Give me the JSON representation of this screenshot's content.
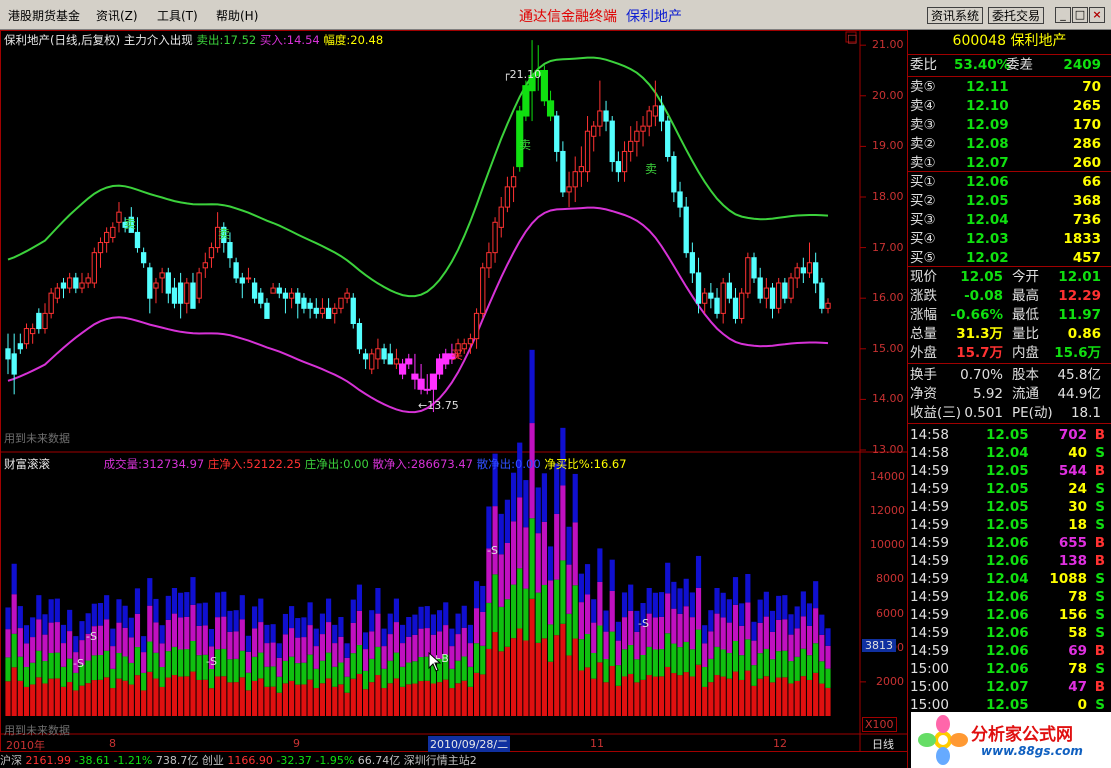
{
  "menu": {
    "items": [
      "港股期货基金",
      "资讯(Z)",
      "工具(T)",
      "帮助(H)"
    ],
    "center_a": "通达信金融终端",
    "center_b": "保利地产",
    "btn_info": "资讯系统",
    "btn_trade": "委托交易",
    "win_min": "_",
    "win_max": "□",
    "win_close": "×"
  },
  "colors": {
    "up": "#ff3232",
    "down": "#54ffff",
    "ma_upper": "#3cd23c",
    "ma_lower": "#d632d6",
    "grid_red": "#a00000",
    "vol_red": "#e01010",
    "vol_green": "#10c010",
    "vol_magenta": "#c010c0",
    "vol_blue": "#1010d0"
  },
  "price_pane": {
    "legend": {
      "stock": "保利地产(日线,后复权)",
      "indicator": "主力介入出现",
      "sell_label": "卖出:",
      "sell_value": "17.52",
      "buy_label": "买入:",
      "buy_value": "14.54",
      "range_label": "幅度:",
      "range_value": "20.48"
    },
    "yaxis": [
      "21.00",
      "20.00",
      "19.00",
      "18.00",
      "17.00",
      "16.00",
      "15.00",
      "14.00",
      "13.00"
    ],
    "high_mark": "21.10",
    "low_mark": "13.75",
    "signals": {
      "sell": "卖",
      "buy": "买"
    },
    "watermark": "用到未来数据",
    "corner_box": "□"
  },
  "volume_pane": {
    "title": "财富滚滚",
    "legend": [
      {
        "label": "成交量:",
        "value": "312734.97"
      },
      {
        "label": "庄净入:",
        "value": "52122.25"
      },
      {
        "label": "庄净出:",
        "value": "0.00"
      },
      {
        "label": "散净入:",
        "value": "286673.47"
      },
      {
        "label": "散净出:",
        "value": "0.00"
      },
      {
        "label": "净买比%:",
        "value": "16.67"
      }
    ],
    "yaxis": [
      "14000",
      "12000",
      "10000",
      "8000",
      "6000",
      "4000",
      "2000"
    ],
    "current": "3813",
    "multiplier": "X100",
    "watermark": "用到未来数据",
    "marks": {
      "s": "S",
      "b": "B",
      "s_marker": "-S",
      "b_marker": "+B"
    }
  },
  "date_axis": {
    "ticks": [
      "2010年",
      "8",
      "9",
      "11",
      "12"
    ],
    "cursor": "2010/09/28/二",
    "period": "日线"
  },
  "statusbar": {
    "items": [
      "沪深",
      "2161.99",
      "-38.61",
      "-1.21%",
      "738.7亿",
      "创业",
      "1166.90",
      "-32.37",
      "-1.95%",
      "66.74亿",
      "深圳行情主站2"
    ]
  },
  "quote": {
    "code": "600048",
    "name": "保利地产",
    "wb_label": "委比",
    "wb_value": "53.40%",
    "wc_label": "委差",
    "wc_value": "2409",
    "sell": [
      {
        "label": "卖⑤",
        "price": "12.11",
        "vol": "70"
      },
      {
        "label": "卖④",
        "price": "12.10",
        "vol": "265"
      },
      {
        "label": "卖③",
        "price": "12.09",
        "vol": "170"
      },
      {
        "label": "卖②",
        "price": "12.08",
        "vol": "286"
      },
      {
        "label": "卖①",
        "price": "12.07",
        "vol": "260"
      }
    ],
    "buy": [
      {
        "label": "买①",
        "price": "12.06",
        "vol": "66"
      },
      {
        "label": "买②",
        "price": "12.05",
        "vol": "368"
      },
      {
        "label": "买③",
        "price": "12.04",
        "vol": "736"
      },
      {
        "label": "买④",
        "price": "12.03",
        "vol": "1833"
      },
      {
        "label": "买⑤",
        "price": "12.02",
        "vol": "457"
      }
    ],
    "stats": [
      {
        "l1": "现价",
        "v1": "12.05",
        "c1": "#10e010",
        "l2": "今开",
        "v2": "12.01",
        "c2": "#10e010"
      },
      {
        "l1": "涨跌",
        "v1": "-0.08",
        "c1": "#10e010",
        "l2": "最高",
        "v2": "12.29",
        "c2": "#ff3232"
      },
      {
        "l1": "涨幅",
        "v1": "-0.66%",
        "c1": "#10e010",
        "l2": "最低",
        "v2": "11.97",
        "c2": "#10e010"
      },
      {
        "l1": "总量",
        "v1": "31.3万",
        "c1": "#ffff00",
        "l2": "量比",
        "v2": "0.86",
        "c2": "#ffff00"
      },
      {
        "l1": "外盘",
        "v1": "15.7万",
        "c1": "#ff3232",
        "l2": "内盘",
        "v2": "15.6万",
        "c2": "#10e010"
      }
    ],
    "finance": [
      {
        "l1": "换手",
        "v1": "0.70%",
        "l2": "股本",
        "v2": "45.8亿"
      },
      {
        "l1": "净资",
        "v1": "5.92",
        "l2": "流通",
        "v2": "44.9亿"
      },
      {
        "l1": "收益(三)",
        "v1": "0.501",
        "l2": "PE(动)",
        "v2": "18.1"
      }
    ],
    "ticks": [
      {
        "time": "14:58",
        "price": "12.05",
        "vol": "702",
        "side": "B"
      },
      {
        "time": "14:58",
        "price": "12.04",
        "vol": "40",
        "side": "S"
      },
      {
        "time": "14:59",
        "price": "12.05",
        "vol": "544",
        "side": "B"
      },
      {
        "time": "14:59",
        "price": "12.05",
        "vol": "24",
        "side": "S"
      },
      {
        "time": "14:59",
        "price": "12.05",
        "vol": "30",
        "side": "S"
      },
      {
        "time": "14:59",
        "price": "12.05",
        "vol": "18",
        "side": "S"
      },
      {
        "time": "14:59",
        "price": "12.06",
        "vol": "655",
        "side": "B"
      },
      {
        "time": "14:59",
        "price": "12.06",
        "vol": "138",
        "side": "B"
      },
      {
        "time": "14:59",
        "price": "12.04",
        "vol": "1088",
        "side": "S"
      },
      {
        "time": "14:59",
        "price": "12.06",
        "vol": "78",
        "side": "S"
      },
      {
        "time": "14:59",
        "price": "12.06",
        "vol": "156",
        "side": "S"
      },
      {
        "time": "14:59",
        "price": "12.06",
        "vol": "58",
        "side": "S"
      },
      {
        "time": "14:59",
        "price": "12.06",
        "vol": "69",
        "side": "B"
      },
      {
        "time": "15:00",
        "price": "12.06",
        "vol": "78",
        "side": "S"
      },
      {
        "time": "15:00",
        "price": "12.07",
        "vol": "47",
        "side": "B"
      },
      {
        "time": "15:00",
        "price": "12.05",
        "vol": "0",
        "side": "S"
      }
    ]
  },
  "logo": {
    "text": "分析家公式网",
    "url": "www.88gs.com"
  },
  "chart_data": {
    "type": "candlestick",
    "period": "daily",
    "ylim": [
      13.0,
      21.3
    ],
    "candles": [
      [
        15.0,
        15.3,
        14.5,
        14.8
      ],
      [
        14.9,
        15.3,
        14.1,
        14.5
      ],
      [
        15.1,
        15.3,
        14.9,
        15.0
      ],
      [
        15.1,
        15.5,
        15.0,
        15.4
      ],
      [
        15.3,
        15.5,
        15.1,
        15.4
      ],
      [
        15.7,
        15.8,
        15.3,
        15.4
      ],
      [
        15.4,
        15.9,
        15.3,
        15.7
      ],
      [
        15.7,
        16.2,
        15.6,
        16.1
      ],
      [
        16.0,
        16.3,
        15.9,
        16.2
      ],
      [
        16.3,
        16.4,
        16.0,
        16.2
      ],
      [
        16.2,
        16.5,
        16.1,
        16.4
      ],
      [
        16.4,
        16.5,
        16.1,
        16.2
      ],
      [
        16.2,
        16.5,
        16.1,
        16.3
      ],
      [
        16.3,
        16.5,
        16.2,
        16.4
      ],
      [
        16.3,
        17.0,
        16.2,
        16.9
      ],
      [
        16.9,
        17.2,
        16.6,
        17.1
      ],
      [
        17.1,
        17.4,
        16.9,
        17.3
      ],
      [
        17.2,
        17.5,
        17.1,
        17.4
      ],
      [
        17.5,
        17.9,
        17.3,
        17.7
      ],
      [
        17.5,
        17.6,
        17.3,
        17.4
      ],
      [
        17.6,
        17.8,
        17.3,
        17.3
      ],
      [
        17.3,
        17.6,
        16.9,
        17.0
      ],
      [
        16.9,
        17.0,
        16.6,
        16.7
      ],
      [
        16.6,
        16.7,
        15.7,
        16.0
      ],
      [
        16.2,
        16.4,
        15.9,
        16.3
      ],
      [
        16.4,
        16.6,
        16.1,
        16.5
      ],
      [
        16.5,
        16.6,
        15.9,
        16.1
      ],
      [
        16.2,
        16.4,
        15.8,
        15.9
      ],
      [
        16.3,
        16.5,
        15.6,
        15.9
      ],
      [
        15.9,
        16.4,
        15.7,
        16.3
      ],
      [
        16.3,
        16.5,
        15.8,
        15.8
      ],
      [
        16.0,
        16.6,
        15.9,
        16.5
      ],
      [
        16.6,
        16.9,
        16.4,
        16.7
      ],
      [
        16.8,
        17.1,
        16.6,
        17.0
      ],
      [
        17.0,
        17.7,
        16.9,
        17.4
      ],
      [
        17.4,
        17.5,
        16.9,
        17.1
      ],
      [
        17.1,
        17.3,
        16.6,
        16.8
      ],
      [
        16.7,
        16.8,
        16.3,
        16.4
      ],
      [
        16.4,
        16.5,
        16.0,
        16.3
      ],
      [
        16.4,
        16.6,
        16.3,
        16.4
      ],
      [
        16.3,
        16.4,
        15.9,
        16.0
      ],
      [
        16.1,
        16.2,
        15.8,
        15.9
      ],
      [
        15.9,
        16.0,
        15.6,
        15.6
      ],
      [
        16.1,
        16.3,
        16.1,
        16.2
      ],
      [
        16.2,
        16.3,
        16.0,
        16.1
      ],
      [
        16.1,
        16.2,
        15.7,
        16.0
      ],
      [
        16.0,
        16.2,
        15.8,
        16.1
      ],
      [
        16.1,
        16.2,
        15.6,
        15.9
      ],
      [
        16.0,
        16.1,
        15.7,
        15.8
      ],
      [
        15.9,
        16.0,
        15.6,
        15.8
      ],
      [
        15.8,
        16.0,
        15.6,
        15.7
      ],
      [
        15.7,
        16.0,
        15.6,
        15.8
      ],
      [
        15.8,
        16.0,
        15.6,
        15.6
      ],
      [
        15.7,
        15.9,
        15.5,
        15.8
      ],
      [
        15.8,
        16.0,
        15.7,
        16.0
      ],
      [
        16.0,
        16.2,
        15.9,
        16.1
      ],
      [
        16.0,
        16.1,
        15.4,
        15.5
      ],
      [
        15.5,
        15.6,
        14.9,
        15.0
      ],
      [
        14.9,
        15.0,
        14.6,
        14.8
      ],
      [
        14.6,
        15.0,
        14.5,
        14.9
      ],
      [
        14.8,
        15.2,
        14.6,
        15.0
      ],
      [
        15.0,
        15.1,
        14.7,
        14.8
      ],
      [
        14.9,
        15.1,
        14.7,
        14.7
      ],
      [
        14.7,
        15.0,
        14.6,
        14.8
      ],
      [
        14.7,
        14.8,
        14.4,
        14.5
      ],
      [
        14.7,
        14.9,
        14.6,
        14.8
      ],
      [
        14.5,
        14.9,
        14.2,
        14.4
      ],
      [
        14.4,
        14.7,
        14.1,
        14.2
      ],
      [
        14.2,
        14.5,
        14.1,
        14.2
      ],
      [
        14.2,
        14.4,
        13.75,
        14.5
      ],
      [
        14.5,
        14.9,
        14.4,
        14.8
      ],
      [
        14.7,
        15.0,
        14.6,
        14.9
      ],
      [
        14.8,
        15.1,
        14.7,
        14.9
      ],
      [
        14.9,
        15.2,
        14.8,
        15.1
      ],
      [
        15.0,
        15.2,
        14.9,
        15.1
      ],
      [
        15.1,
        15.3,
        14.9,
        15.2
      ],
      [
        15.2,
        15.8,
        15.0,
        15.7
      ],
      [
        15.7,
        16.7,
        15.6,
        16.6
      ],
      [
        16.6,
        17.1,
        16.4,
        16.9
      ],
      [
        16.9,
        17.6,
        16.7,
        17.5
      ],
      [
        17.4,
        18.0,
        17.2,
        17.8
      ],
      [
        17.8,
        18.4,
        17.7,
        18.2
      ],
      [
        18.2,
        18.6,
        17.9,
        18.4
      ],
      [
        18.6,
        19.8,
        18.5,
        19.7
      ],
      [
        19.6,
        20.3,
        19.5,
        20.2
      ],
      [
        20.1,
        21.1,
        19.5,
        20.4
      ],
      [
        20.4,
        21.0,
        20.1,
        20.5
      ],
      [
        20.5,
        20.6,
        19.8,
        19.9
      ],
      [
        19.9,
        20.1,
        19.5,
        19.6
      ],
      [
        19.6,
        19.7,
        18.7,
        18.9
      ],
      [
        18.9,
        19.1,
        18.0,
        18.1
      ],
      [
        18.1,
        18.5,
        17.8,
        18.2
      ],
      [
        18.2,
        18.8,
        17.9,
        18.5
      ],
      [
        18.5,
        19.0,
        18.2,
        18.6
      ],
      [
        18.5,
        19.6,
        18.3,
        19.3
      ],
      [
        19.2,
        19.5,
        18.9,
        19.4
      ],
      [
        19.4,
        20.3,
        19.2,
        19.7
      ],
      [
        19.7,
        19.9,
        19.3,
        19.5
      ],
      [
        19.5,
        19.6,
        18.5,
        18.7
      ],
      [
        18.7,
        18.9,
        18.3,
        18.5
      ],
      [
        18.5,
        19.1,
        18.3,
        18.9
      ],
      [
        18.9,
        19.4,
        18.7,
        19.1
      ],
      [
        19.1,
        19.5,
        18.8,
        19.3
      ],
      [
        19.3,
        19.6,
        19.0,
        19.4
      ],
      [
        19.4,
        19.8,
        19.2,
        19.7
      ],
      [
        19.6,
        20.3,
        19.4,
        19.8
      ],
      [
        19.8,
        20.0,
        19.3,
        19.5
      ],
      [
        19.5,
        19.6,
        18.7,
        18.8
      ],
      [
        18.8,
        18.9,
        17.9,
        18.1
      ],
      [
        18.1,
        18.3,
        17.6,
        17.8
      ],
      [
        17.8,
        18.0,
        16.8,
        16.9
      ],
      [
        16.9,
        17.1,
        16.3,
        16.5
      ],
      [
        16.5,
        16.8,
        15.7,
        15.9
      ],
      [
        15.9,
        16.2,
        15.7,
        16.1
      ],
      [
        16.1,
        16.3,
        15.8,
        16.0
      ],
      [
        16.0,
        16.2,
        15.6,
        15.7
      ],
      [
        15.7,
        16.4,
        15.5,
        16.3
      ],
      [
        16.3,
        16.5,
        15.9,
        16.0
      ],
      [
        16.0,
        16.2,
        15.5,
        15.6
      ],
      [
        15.6,
        16.2,
        15.5,
        16.1
      ],
      [
        16.1,
        16.9,
        16.0,
        16.8
      ],
      [
        16.8,
        16.9,
        16.3,
        16.4
      ],
      [
        16.4,
        16.6,
        15.9,
        16.0
      ],
      [
        16.0,
        16.4,
        15.8,
        16.2
      ],
      [
        16.2,
        16.3,
        15.6,
        15.8
      ],
      [
        15.8,
        16.4,
        15.7,
        16.3
      ],
      [
        16.3,
        16.4,
        15.9,
        16.0
      ],
      [
        16.0,
        16.5,
        15.9,
        16.4
      ],
      [
        16.4,
        16.7,
        16.2,
        16.6
      ],
      [
        16.6,
        16.8,
        16.3,
        16.5
      ],
      [
        16.5,
        17.1,
        16.4,
        16.7
      ],
      [
        16.7,
        16.9,
        16.1,
        16.3
      ],
      [
        16.3,
        16.4,
        15.7,
        15.8
      ],
      [
        15.8,
        16.0,
        15.7,
        15.9
      ]
    ]
  }
}
